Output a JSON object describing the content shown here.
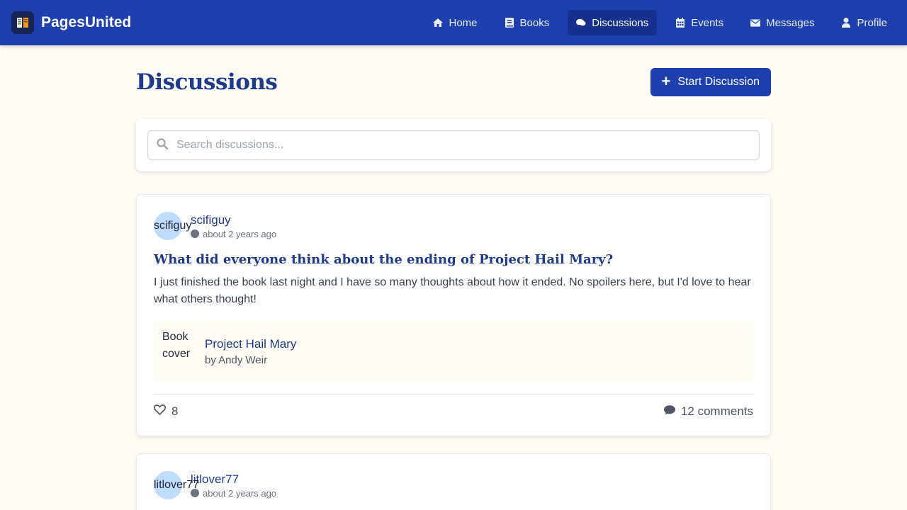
{
  "app": {
    "name": "PagesUnited"
  },
  "nav": [
    {
      "label": "Home",
      "icon": "home-icon"
    },
    {
      "label": "Books",
      "icon": "book-icon"
    },
    {
      "label": "Discussions",
      "icon": "comments-icon"
    },
    {
      "label": "Events",
      "icon": "calendar-icon"
    },
    {
      "label": "Messages",
      "icon": "envelope-icon"
    },
    {
      "label": "Profile",
      "icon": "user-icon"
    }
  ],
  "page": {
    "title": "Discussions",
    "start_button": "Start Discussion"
  },
  "search": {
    "placeholder": "Search discussions..."
  },
  "posts": [
    {
      "author": "scifiguy",
      "avatar_alt": "scifiguy",
      "time": "about 2 years ago",
      "title": "What did everyone think about the ending of Project Hail Mary?",
      "body": "I just finished the book last night and I have so many thoughts about how it ended. No spoilers here, but I'd love to hear what others thought!",
      "book": {
        "cover_alt": "Book cover",
        "title": "Project Hail Mary",
        "author": "by Andy Weir"
      },
      "likes": "8",
      "comments": "12 comments"
    },
    {
      "author": "litlover77",
      "avatar_alt": "litlover77",
      "time": "about 2 years ago"
    }
  ],
  "colors": {
    "nav_bg": "#1e40af",
    "accent": "#1e3a8a",
    "page_bg": "#fffbf5"
  }
}
